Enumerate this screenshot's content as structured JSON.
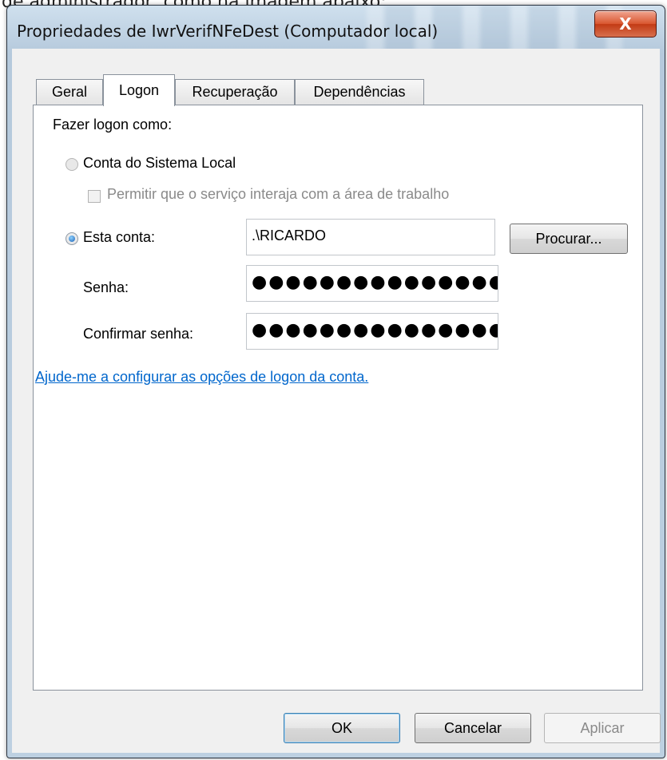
{
  "caption_fragment": "de administrador, como na imagem abaixo:",
  "window": {
    "title": "Propriedades de IwrVerifNFeDest (Computador local)",
    "close_label": "X"
  },
  "tabs": [
    {
      "label": "Geral",
      "active": false
    },
    {
      "label": "Logon",
      "active": true
    },
    {
      "label": "Recuperação",
      "active": false
    },
    {
      "label": "Dependências",
      "active": false
    }
  ],
  "logon": {
    "heading": "Fazer logon como:",
    "local_system_label": "Conta do Sistema Local",
    "local_system_selected": false,
    "interact_desktop_label": "Permitir que o serviço interaja com a área de trabalho",
    "interact_desktop_checked": false,
    "this_account_label": "Esta conta:",
    "this_account_selected": true,
    "account_value": ".\\RICARDO",
    "browse_label": "Procurar...",
    "password_label": "Senha:",
    "password_value": "●●●●●●●●●●●●●●●",
    "confirm_label": "Confirmar senha:",
    "confirm_value": "●●●●●●●●●●●●●●●",
    "help_link": "Ajude-me a configurar as opções de logon da conta."
  },
  "footer": {
    "ok_label": "OK",
    "cancel_label": "Cancelar",
    "apply_label": "Aplicar",
    "apply_enabled": false
  }
}
